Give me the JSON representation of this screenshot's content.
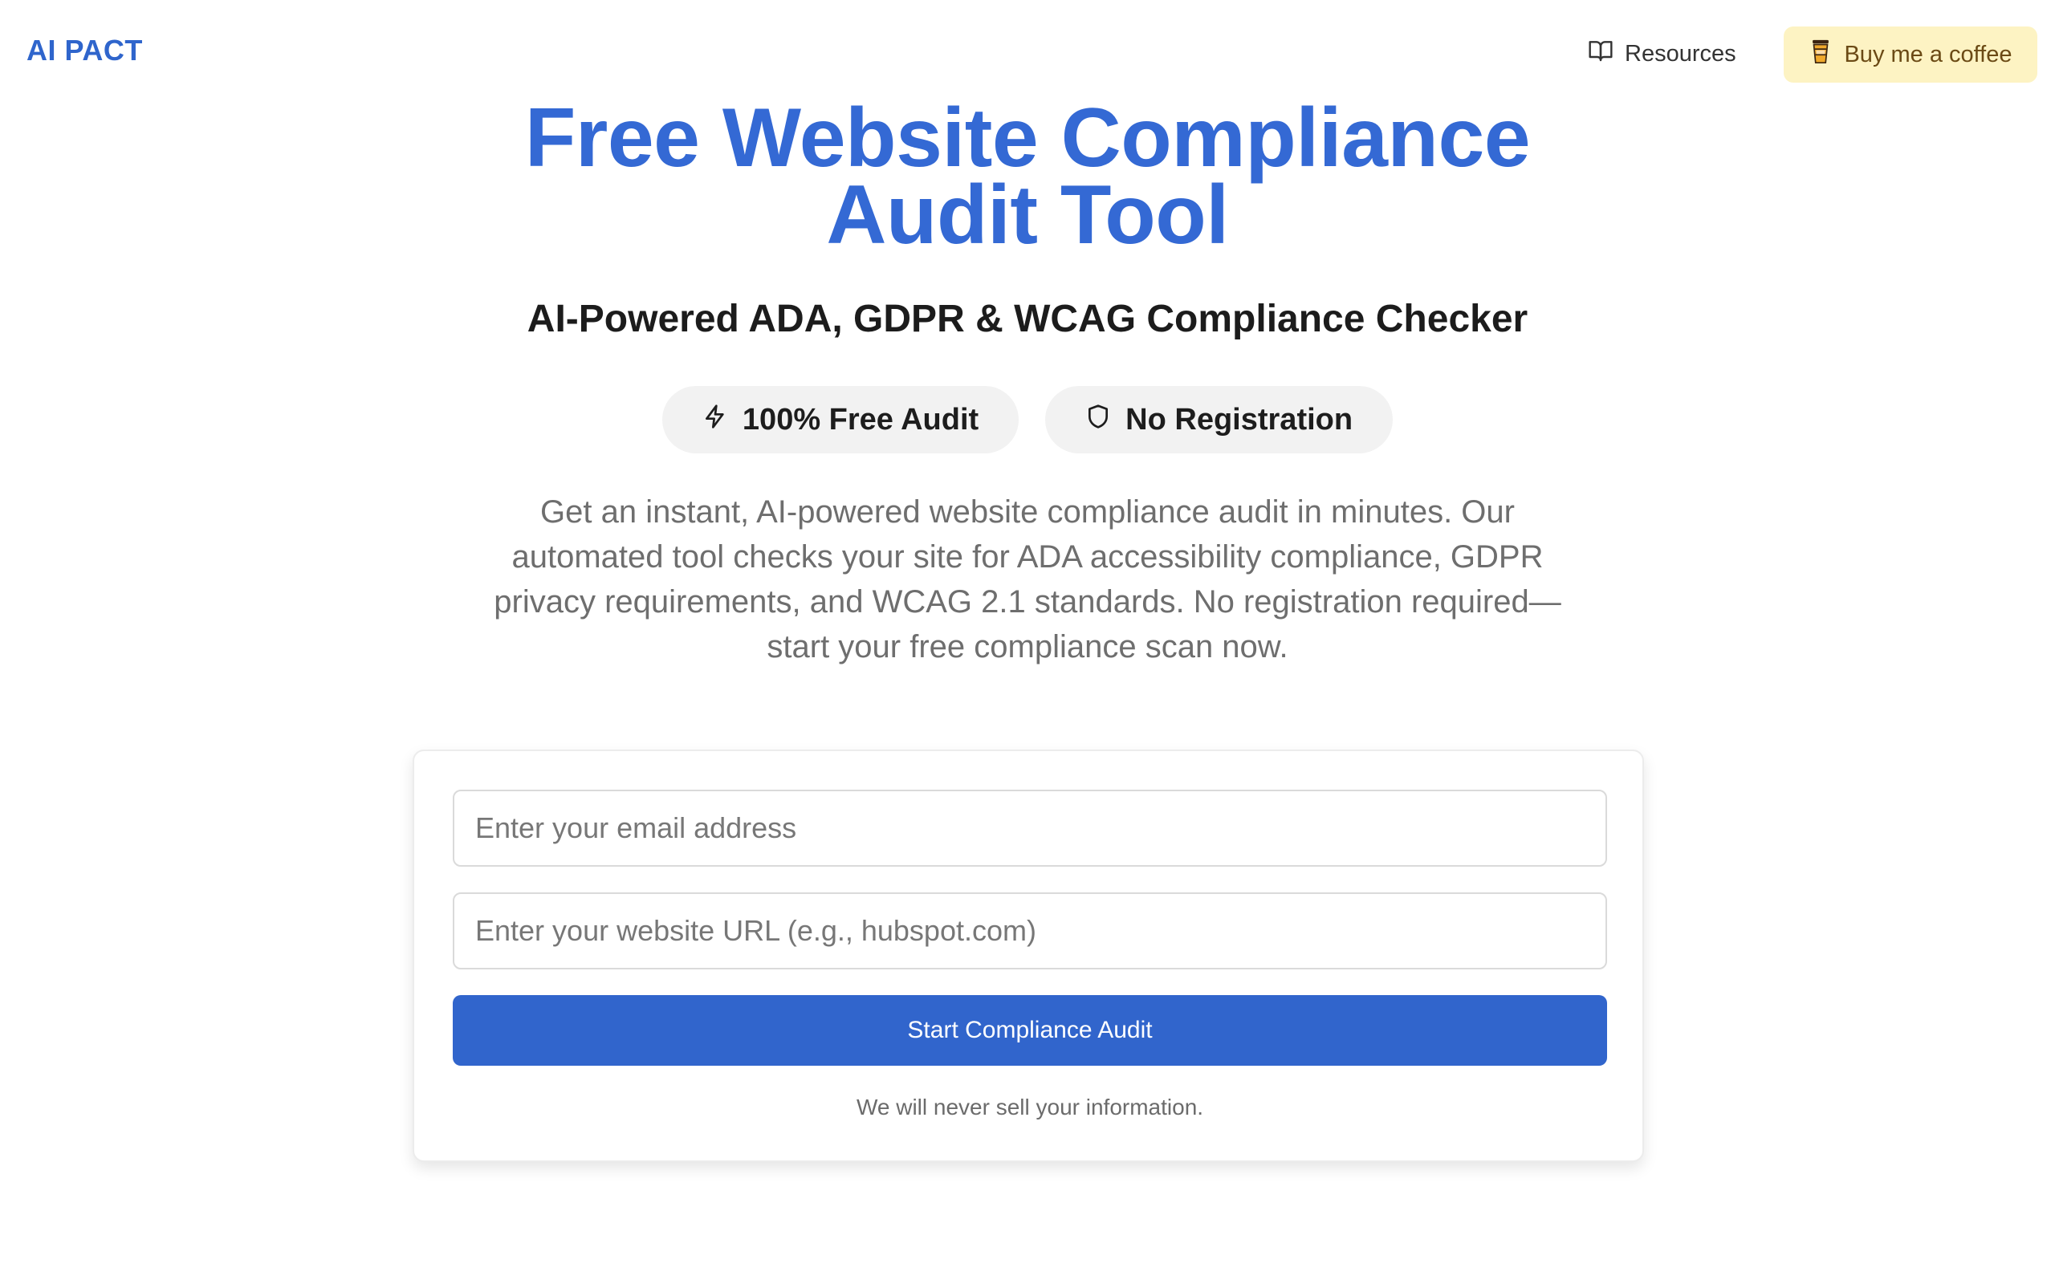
{
  "header": {
    "logo": "AI PACT",
    "nav": {
      "resources_label": "Resources",
      "resources_icon": "book-open-icon"
    },
    "coffee_button": {
      "label": "Buy me a coffee",
      "icon": "coffee-cup-icon",
      "background": "#fdf3c3"
    }
  },
  "hero": {
    "title": "Free Website Compliance Audit Tool",
    "subtitle": "AI-Powered ADA, GDPR & WCAG Compliance Checker",
    "badges": [
      {
        "label": "100% Free Audit",
        "icon": "lightning-icon"
      },
      {
        "label": "No Registration",
        "icon": "shield-icon"
      }
    ],
    "description": "Get an instant, AI-powered website compliance audit in minutes. Our automated tool checks your site for ADA accessibility compliance, GDPR privacy requirements, and WCAG 2.1 standards. No registration required—start your free compliance scan now."
  },
  "form": {
    "email": {
      "value": "",
      "placeholder": "Enter your email address"
    },
    "url": {
      "value": "",
      "placeholder": "Enter your website URL (e.g., hubspot.com)"
    },
    "submit_label": "Start Compliance Audit",
    "privacy_note": "We will never sell your information."
  },
  "colors": {
    "brand": "#3469d4",
    "button": "#3165cc",
    "badge_bg": "#f2f2f2"
  }
}
